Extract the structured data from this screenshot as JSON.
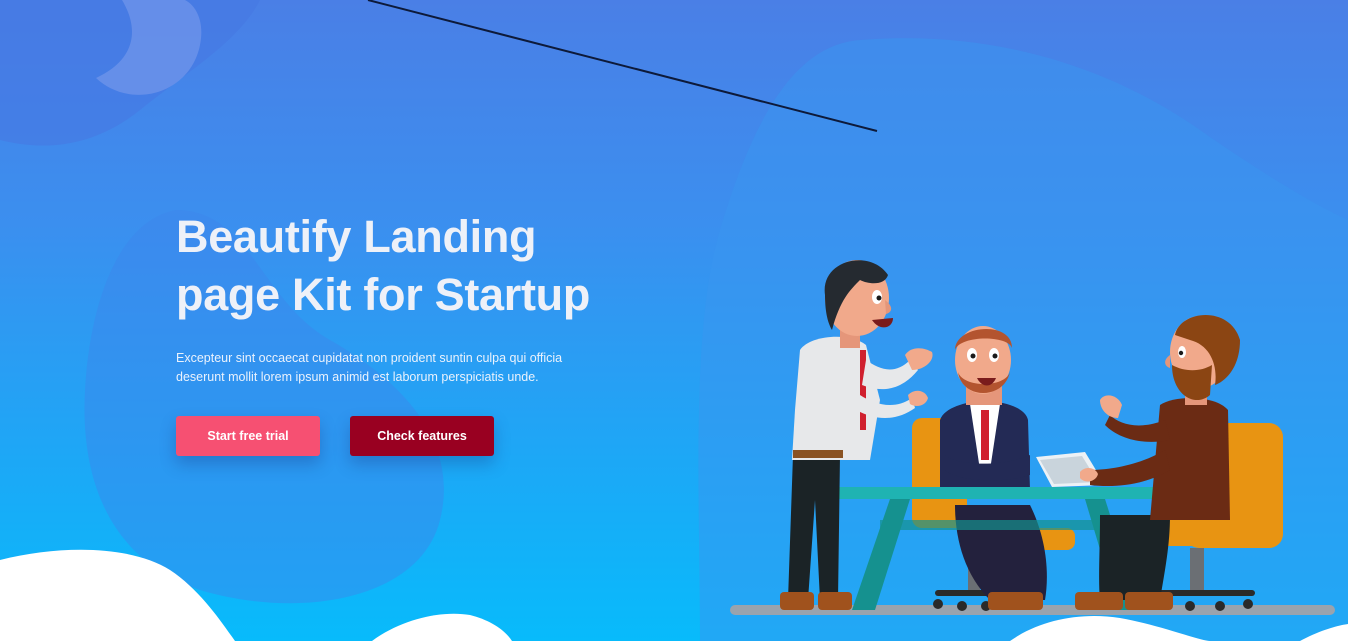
{
  "hero": {
    "title_line1": "Beautify Landing",
    "title_line2": "page Kit for Startup",
    "description": "Excepteur sint occaecat cupidatat non proident suntin culpa qui officia deserunt mollit lorem ipsum animid est laborum perspiciatis unde.",
    "primary_button": "Start free trial",
    "secondary_button": "Check features"
  },
  "illustration": "office-meeting-illustration",
  "colors": {
    "gradient_top": "#4a7fe6",
    "gradient_bottom": "#08bbfb",
    "primary_button": "#f65072",
    "secondary_button": "#990021",
    "title_text": "#eef1f8"
  }
}
